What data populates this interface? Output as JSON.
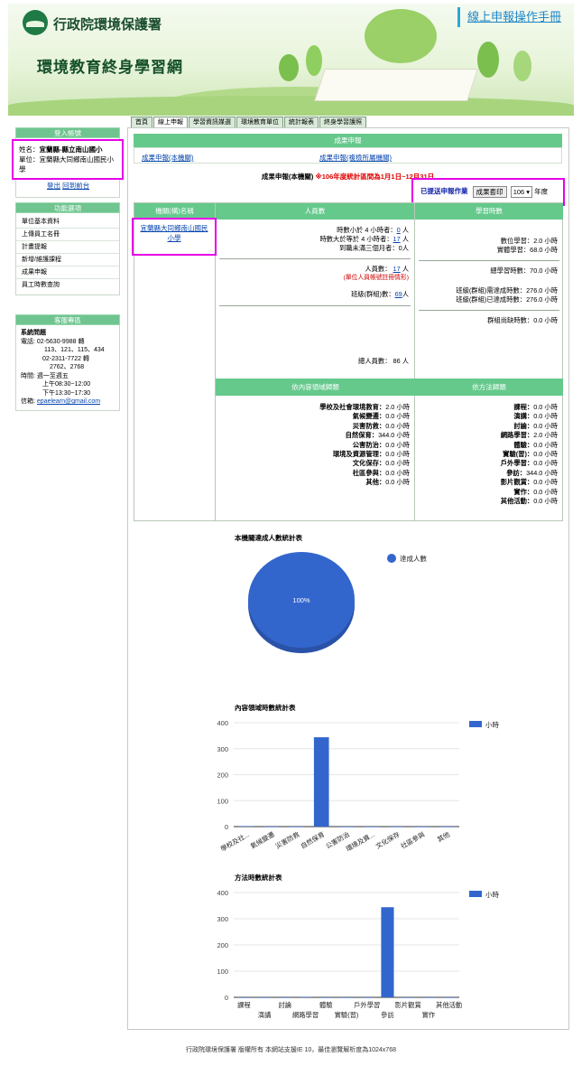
{
  "header": {
    "org_name": "行政院環境保護署",
    "site_title": "環境教育終身學習網",
    "manual_link": "線上申報操作手冊"
  },
  "nav": {
    "tabs": [
      {
        "label": "首頁",
        "active": false
      },
      {
        "label": "線上申報",
        "active": true
      },
      {
        "label": "學習資訊媒選",
        "active": false
      },
      {
        "label": "環境教育單位",
        "active": false
      },
      {
        "label": "統計報表",
        "active": false
      },
      {
        "label": "終身學習護照",
        "active": false
      }
    ]
  },
  "sidebar": {
    "login": {
      "heading": "登入帳號",
      "name_label": "姓名：",
      "name_value": "宜蘭縣-縣立南山國小",
      "unit_label": "單位：",
      "unit_value": "宜蘭縣大同鄉南山國民小學",
      "logout": "登出",
      "home": "回到前台"
    },
    "functions": {
      "heading": "功能選項",
      "items": [
        "單位基本資料",
        "上傳員工名冊",
        "計畫提報",
        "新增/維護課程",
        "成果申報",
        "員工時數查詢"
      ]
    },
    "support": {
      "heading": "客服專區",
      "title": "系統問題",
      "phone_label": "電話:",
      "phone1": "02-5630-9988 轉",
      "phone1_ext": "113、121、115、434",
      "phone2": "02-2311-7722 轉",
      "phone2_ext": "2762、2768",
      "hours_label": "時間:",
      "hours_days": "週一至週五",
      "hours_am": "上午08:30~12:00",
      "hours_pm": "下午13:30~17:30",
      "email_label": "信箱:",
      "email": "epaelearn@gmail.com"
    }
  },
  "main": {
    "section_title": "成果申報",
    "subtab_left": "成果申報(本機關)",
    "subtab_right": "成果申報(複檢所屬機關)",
    "result_title": "成果申報(本機關)",
    "result_period": "※106年度統計區間為1月1日~12月31日",
    "sent_label": "已提送申報作業",
    "print_button": "成果套印",
    "year_value": "106",
    "year_suffix": "年度"
  },
  "table": {
    "col_agency": "機關(構)名稱",
    "col_people": "人員數",
    "col_hours": "學習時數",
    "agency_name_line1": "宜蘭縣大同鄉南山國民",
    "agency_name_line2": "小學",
    "people": {
      "under4_label": "時數小於 4 小時者：",
      "under4_value": "0",
      "over4_label": "時數大於等於 4 小時者：",
      "over4_value": "17",
      "left_label": "到職未滿三個月者：",
      "left_value": "0",
      "unit": "人",
      "people_count_label": "人員數：",
      "people_count_value": "17",
      "people_note": "(單位人員帳號註冊情形)",
      "class_count_label": "班級(群組)數：",
      "class_count_value": "69",
      "total_label": "總人員數：",
      "total_value": "86"
    },
    "hours": {
      "digital_label": "數位學習：",
      "digital_value": "2.0",
      "physical_label": "實體學習：",
      "physical_value": "68.0",
      "total_label": "總學習時數：",
      "total_value": "70.0",
      "class_goal_label": "班級(群組)需達成時數：",
      "class_goal_value": "276.0",
      "class_done_label": "班級(群組)已達成時數：",
      "class_done_value": "276.0",
      "class_lack_label": "群組尚缺時數：",
      "class_lack_value": "0.0",
      "unit": "小時"
    },
    "by_content_heading": "依內容領域歸類",
    "by_method_heading": "依方法歸類",
    "content_rows": [
      {
        "label": "學校及社會環境教育：",
        "value": "2.0"
      },
      {
        "label": "氣候變遷：",
        "value": "0.0"
      },
      {
        "label": "災害防救：",
        "value": "0.0"
      },
      {
        "label": "自然保育：",
        "value": "344.0"
      },
      {
        "label": "公害防治：",
        "value": "0.0"
      },
      {
        "label": "環境及資源管理：",
        "value": "0.0"
      },
      {
        "label": "文化保存：",
        "value": "0.0"
      },
      {
        "label": "社區參與：",
        "value": "0.0"
      },
      {
        "label": "其他：",
        "value": "0.0"
      }
    ],
    "method_rows": [
      {
        "label": "課程：",
        "value": "0.0"
      },
      {
        "label": "演講：",
        "value": "0.0"
      },
      {
        "label": "討論：",
        "value": "0.0"
      },
      {
        "label": "網路學習：",
        "value": "2.0"
      },
      {
        "label": "體驗：",
        "value": "0.0"
      },
      {
        "label": "實驗(習)：",
        "value": "0.0"
      },
      {
        "label": "戶外學習：",
        "value": "0.0"
      },
      {
        "label": "參訪：",
        "value": "344.0"
      },
      {
        "label": "影片觀賞：",
        "value": "0.0"
      },
      {
        "label": "實作：",
        "value": "0.0"
      },
      {
        "label": "其他活動：",
        "value": "0.0"
      }
    ]
  },
  "chart_data": [
    {
      "type": "pie",
      "title": "本機關達成人數統計表",
      "categories": [
        "達成人數"
      ],
      "values": [
        100
      ],
      "data_labels": [
        "100%"
      ],
      "color": "#3366cc",
      "legend": "top-right"
    },
    {
      "type": "bar",
      "title": "內容領域時數統計表",
      "categories": [
        "學校及社...",
        "氣候變遷",
        "災害防救",
        "自然保育",
        "公害防治",
        "環境及資...",
        "文化保存",
        "社區參與",
        "其他"
      ],
      "series": [
        {
          "name": "小時",
          "values": [
            2,
            0,
            0,
            344,
            0,
            0,
            0,
            0,
            0
          ]
        }
      ],
      "ylim": [
        0,
        400
      ],
      "yticks": [
        0,
        100,
        200,
        300,
        400
      ],
      "color": "#3366cc",
      "legend": "right"
    },
    {
      "type": "bar",
      "title": "方法時數統計表",
      "categories": [
        "課程",
        "演講",
        "討論",
        "網路學習",
        "體驗",
        "實驗(習)",
        "戶外學習",
        "參訪",
        "影片觀賞",
        "實作",
        "其他活動"
      ],
      "series": [
        {
          "name": "小時",
          "values": [
            0,
            0,
            0,
            2,
            0,
            0,
            0,
            344,
            0,
            0,
            0
          ]
        }
      ],
      "ylim": [
        0,
        400
      ],
      "yticks": [
        0,
        100,
        200,
        300,
        400
      ],
      "color": "#3366cc",
      "legend": "right"
    }
  ],
  "footer": {
    "text": "行政院環境保護署 版權所有 本網站支援IE 10，最佳瀏覽解析度為1024x768"
  }
}
